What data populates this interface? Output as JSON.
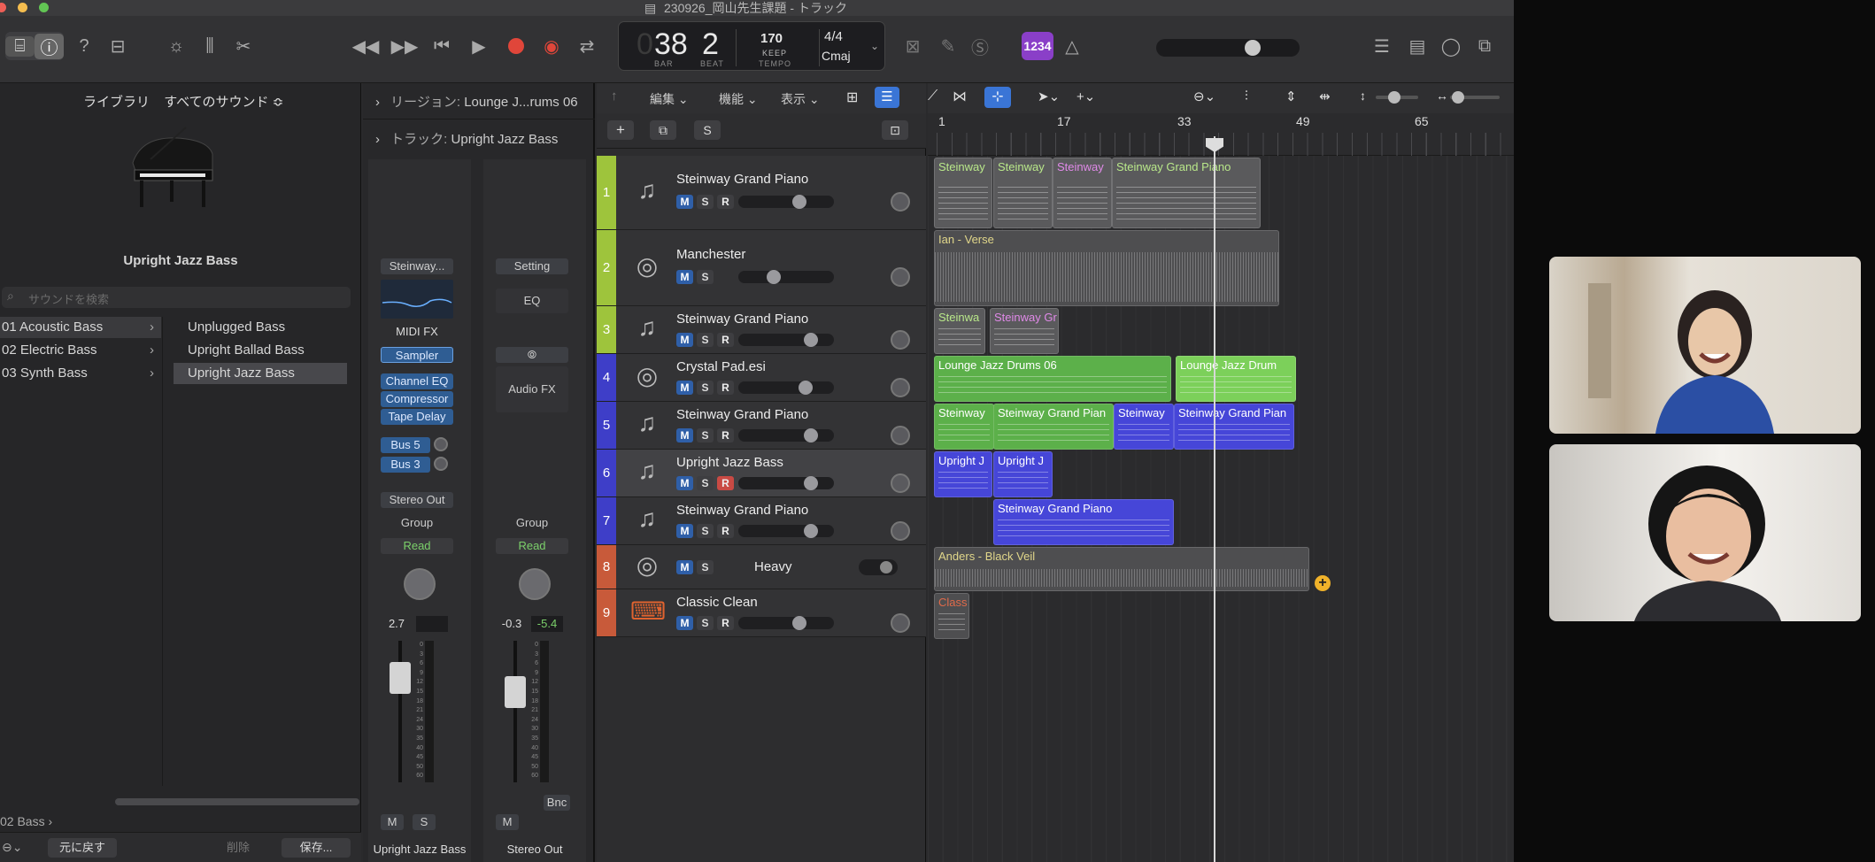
{
  "window": {
    "title": "230926_岡山先生課題 - トラック"
  },
  "lcd": {
    "bar": "38",
    "beat": "2",
    "bar_label": "BAR",
    "beat_label": "BEAT",
    "tempo": "170",
    "keep": "KEEP",
    "tempo_label": "TEMPO",
    "signature": "4/4",
    "key": "Cmaj"
  },
  "toolbar": {
    "count_in": "1234"
  },
  "library": {
    "header_label": "ライブラリ",
    "filter": "すべてのサウンド ≎",
    "patch_name": "Upright Jazz Bass",
    "search_placeholder": "サウンドを検索",
    "categories": [
      "01 Acoustic Bass",
      "02 Electric Bass",
      "03 Synth Bass"
    ],
    "patches": [
      "Unplugged Bass",
      "Upright Ballad Bass",
      "Upright Jazz Bass"
    ],
    "footer_path": "02 Bass",
    "revert_button": "元に戻す",
    "delete_button": "削除",
    "save_button": "保存..."
  },
  "inspector": {
    "region_label": "リージョン:",
    "region_value": "Lounge J...rums 06",
    "track_label": "トラック:",
    "track_value": "Upright Jazz Bass",
    "strip1": {
      "setting": "Steinway...",
      "midi_fx": "MIDI FX",
      "instrument": "Sampler",
      "fx": [
        "Channel EQ",
        "Compressor",
        "Tape Delay"
      ],
      "sends": [
        "Bus 5",
        "Bus 3"
      ],
      "output": "Stereo Out",
      "group": "Group",
      "automation": "Read",
      "pan_value": "2.7",
      "mute": "M",
      "solo": "S",
      "name": "Upright Jazz Bass"
    },
    "strip2": {
      "setting": "Setting",
      "eq": "EQ",
      "audio_fx": "Audio FX",
      "group": "Group",
      "automation": "Read",
      "pan_value": "-0.3",
      "peak_value": "-5.4",
      "mute": "M",
      "bounce": "Bnc",
      "name": "Stereo Out"
    },
    "fader_scale": [
      "0",
      "3",
      "6",
      "9",
      "12",
      "15",
      "18",
      "21",
      "24",
      "30",
      "35",
      "40",
      "45",
      "50",
      "60"
    ]
  },
  "menus": {
    "edit": "編集",
    "function": "機能",
    "view": "表示"
  },
  "header_buttons": {
    "solo": "S"
  },
  "ruler": {
    "marks": [
      "1",
      "17",
      "33",
      "49",
      "65"
    ]
  },
  "tracks": [
    {
      "num": "1",
      "name": "Steinway Grand Piano",
      "color": "#9ec43c",
      "icon": "piano-icon",
      "m": "M",
      "s": "S",
      "r": "R",
      "armed": false,
      "level": 0.66
    },
    {
      "num": "2",
      "name": "Manchester",
      "color": "#9ec43c",
      "icon": "drum-kit-icon",
      "m": "M",
      "s": "S",
      "level": 0.35
    },
    {
      "num": "3",
      "name": "Steinway Grand Piano",
      "color": "#9ec43c",
      "icon": "piano-icon",
      "m": "M",
      "s": "S",
      "r": "R",
      "armed": false,
      "level": 0.8
    },
    {
      "num": "4",
      "name": "Crystal Pad.esi",
      "color": "#3e3ec8",
      "icon": "drum-kit-icon",
      "m": "M",
      "s": "S",
      "r": "R",
      "armed": false,
      "level": 0.74
    },
    {
      "num": "5",
      "name": "Steinway Grand Piano",
      "color": "#3e3ec8",
      "icon": "piano-icon",
      "m": "M",
      "s": "S",
      "r": "R",
      "armed": false,
      "level": 0.8
    },
    {
      "num": "6",
      "name": "Upright Jazz Bass",
      "color": "#3e3ec8",
      "icon": "piano-icon",
      "m": "M",
      "s": "S",
      "r": "R",
      "armed": true,
      "level": 0.8
    },
    {
      "num": "7",
      "name": "Steinway Grand Piano",
      "color": "#3e3ec8",
      "icon": "piano-icon",
      "m": "M",
      "s": "S",
      "r": "R",
      "armed": false,
      "level": 0.8
    },
    {
      "num": "8",
      "name": "Heavy",
      "color": "#c85a3a",
      "icon": "drum-kit-icon",
      "m": "M",
      "s": "S"
    },
    {
      "num": "9",
      "name": "Classic Clean",
      "color": "#c85a3a",
      "icon": "keyboard-icon",
      "m": "M",
      "s": "S",
      "r": "R",
      "armed": false,
      "level": 0.66
    }
  ],
  "regions": [
    {
      "label": "Steinway",
      "color": "#5a5a5c",
      "text": "#b9e88a"
    },
    {
      "label": "Steinway",
      "color": "#5a5a5c",
      "text": "#b9e88a"
    },
    {
      "label": "Steinway",
      "color": "#5a5a5c",
      "text": "#e08ae8"
    },
    {
      "label": "Steinway Grand Piano",
      "color": "#5a5a5c",
      "text": "#b9e88a"
    },
    {
      "label": "Ian - Verse",
      "color": "#4e4e50",
      "text": "#e0d68a"
    },
    {
      "label": "Steinwa",
      "color": "#5a5a5c",
      "text": "#b9e88a"
    },
    {
      "label": "Steinway Gr",
      "color": "#5a5a5c",
      "text": "#e08ae8"
    },
    {
      "label": "Lounge Jazz Drums 06",
      "color": "#5cb04a",
      "text": "#ffffff"
    },
    {
      "label": "Lounge Jazz Drum",
      "color": "#7cd05a",
      "text": "#ffffff"
    },
    {
      "label": "Steinway",
      "color": "#5cb04a",
      "text": "#ffffff"
    },
    {
      "label": "Steinway Grand Pian",
      "color": "#5cb04a",
      "text": "#ffffff"
    },
    {
      "label": "Steinway",
      "color": "#4646d8",
      "text": "#ffffff"
    },
    {
      "label": "Steinway Grand Pian",
      "color": "#4646d8",
      "text": "#ffffff"
    },
    {
      "label": "Upright J",
      "color": "#4646d8",
      "text": "#ffffff"
    },
    {
      "label": "Upright J",
      "color": "#4646d8",
      "text": "#ffffff"
    },
    {
      "label": "Steinway Grand Piano",
      "color": "#4646d8",
      "text": "#ffffff"
    },
    {
      "label": "Anders - Black Veil",
      "color": "#4e4e50",
      "text": "#e0d68a"
    },
    {
      "label": "Class",
      "color": "#4e4e50",
      "text": "#e06a4a"
    }
  ]
}
